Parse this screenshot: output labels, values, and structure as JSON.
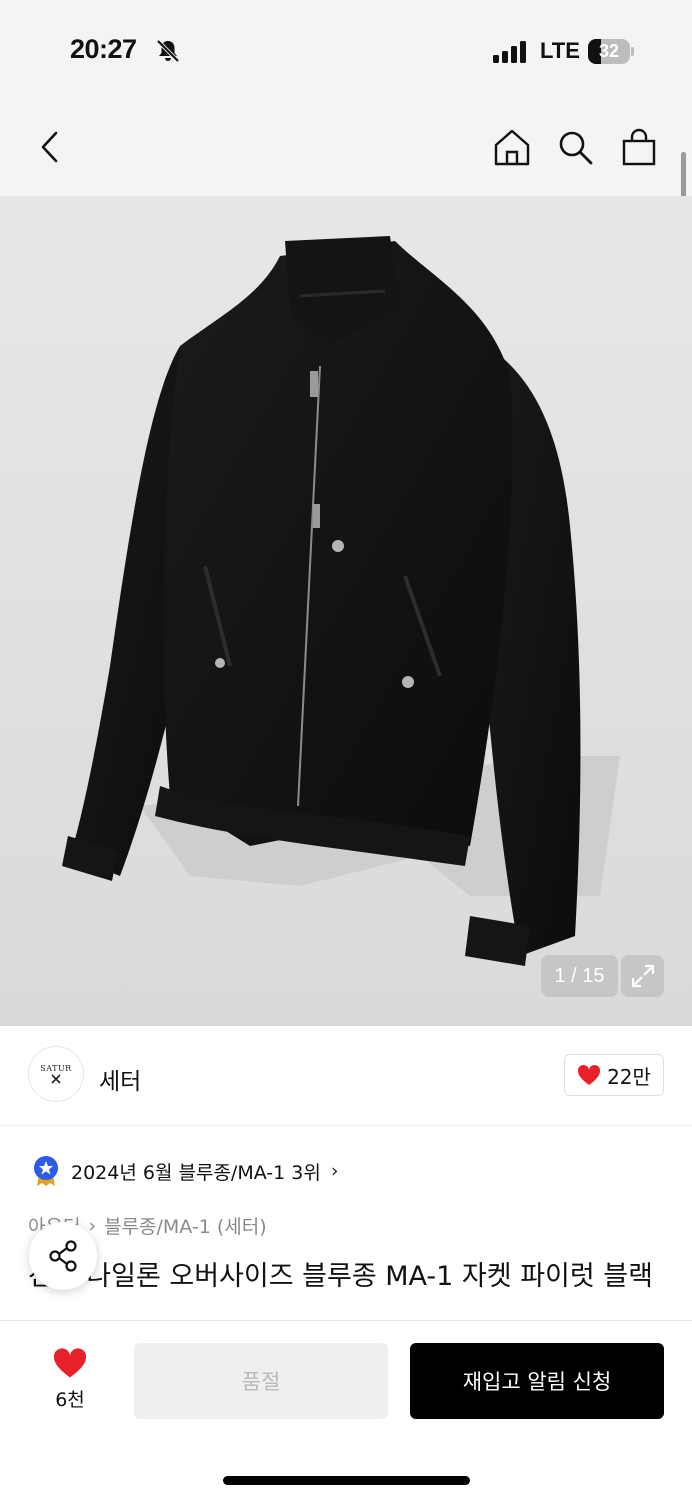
{
  "status_bar": {
    "time": "20:27",
    "network": "LTE",
    "battery": "32",
    "battery_level": 0.32
  },
  "header": {
    "icons": [
      "back-icon",
      "home-icon",
      "search-icon",
      "shopping-bag-icon"
    ]
  },
  "gallery": {
    "counter": "1 / 15",
    "expand_icon": "expand-icon"
  },
  "brand": {
    "logo_text": "SATUR",
    "name": "세터",
    "likes": "22만"
  },
  "ranking": {
    "text": "2024년 6월 블루종/MA-1 3위"
  },
  "breadcrumb": {
    "items": [
      "아우터",
      "블루종/MA-1 (세터)"
    ]
  },
  "product": {
    "title": "션트 나일론 오버사이즈 블루종 MA-1 자켓 파이럿 블랙"
  },
  "bottom_bar": {
    "wish_count": "6천",
    "soldout_label": "품절",
    "restock_label": "재입고 알림 신청"
  },
  "colors": {
    "heart": "#e8202a",
    "accent_black": "#000000",
    "rank_badge": "#2b5be8"
  }
}
